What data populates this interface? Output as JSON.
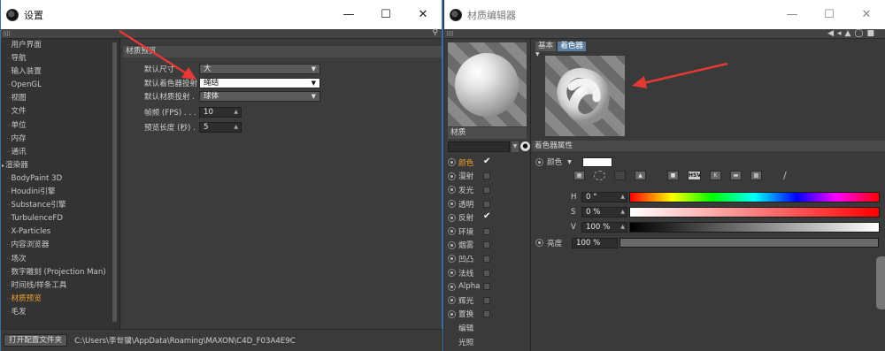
{
  "settings": {
    "title": "设置",
    "sidebar": [
      {
        "label": "用户界面",
        "active": false,
        "expand": false
      },
      {
        "label": "导航",
        "active": false,
        "expand": false
      },
      {
        "label": "输入装置",
        "active": false,
        "expand": false
      },
      {
        "label": "OpenGL",
        "active": false,
        "expand": false
      },
      {
        "label": "视图",
        "active": false,
        "expand": false
      },
      {
        "label": "文件",
        "active": false,
        "expand": false
      },
      {
        "label": "单位",
        "active": false,
        "expand": false
      },
      {
        "label": "内存",
        "active": false,
        "expand": false
      },
      {
        "label": "通讯",
        "active": false,
        "expand": false
      },
      {
        "label": "渲染器",
        "active": false,
        "expand": true
      },
      {
        "label": "BodyPaint 3D",
        "active": false,
        "expand": false
      },
      {
        "label": "Houdini引擎",
        "active": false,
        "expand": false
      },
      {
        "label": "Substance引擎",
        "active": false,
        "expand": false
      },
      {
        "label": "TurbulenceFD",
        "active": false,
        "expand": false
      },
      {
        "label": "X-Particles",
        "active": false,
        "expand": false
      },
      {
        "label": "内容浏览器",
        "active": false,
        "expand": false
      },
      {
        "label": "场次",
        "active": false,
        "expand": false
      },
      {
        "label": "数字雕刻 (Projection Man)",
        "active": false,
        "expand": false
      },
      {
        "label": "时间线/样条工具",
        "active": false,
        "expand": false
      },
      {
        "label": "材质预览",
        "active": true,
        "expand": false
      },
      {
        "label": "毛发",
        "active": false,
        "expand": false
      }
    ],
    "section_title": "材质预览",
    "props": {
      "size_label": "默认尺寸",
      "size_value": "大",
      "shader_label": "默认着色器投射",
      "shader_value": "绳结",
      "material_label": "默认材质投射 .",
      "material_value": "球体",
      "fps_label": "帧频 (FPS) . . . .",
      "fps_value": "10",
      "length_label": "预览长度 (秒) .",
      "length_value": "5"
    },
    "footer": {
      "button": "打开配置文件夹",
      "path": "C:\\Users\\李世骥\\AppData\\Roaming\\MAXON\\C4D_F03A4E9C"
    }
  },
  "material_editor": {
    "title": "材质编辑器",
    "material_name": "材质",
    "channels": [
      {
        "label": "颜色",
        "checked": true,
        "active": true,
        "radio": true
      },
      {
        "label": "漫射",
        "checked": false,
        "active": false,
        "radio": true
      },
      {
        "label": "发光",
        "checked": false,
        "active": false,
        "radio": true
      },
      {
        "label": "透明",
        "checked": false,
        "active": false,
        "radio": true
      },
      {
        "label": "反射",
        "checked": true,
        "active": false,
        "radio": true
      },
      {
        "label": "环境",
        "checked": false,
        "active": false,
        "radio": true
      },
      {
        "label": "烟雾",
        "checked": false,
        "active": false,
        "radio": true
      },
      {
        "label": "凹凸",
        "checked": false,
        "active": false,
        "radio": true
      },
      {
        "label": "法线",
        "checked": false,
        "active": false,
        "radio": true
      },
      {
        "label": "Alpha",
        "checked": false,
        "active": false,
        "radio": true
      },
      {
        "label": "辉光",
        "checked": false,
        "active": false,
        "radio": true
      },
      {
        "label": "置换",
        "checked": false,
        "active": false,
        "radio": true
      },
      {
        "label": "编辑",
        "checked": null,
        "active": false,
        "radio": false
      },
      {
        "label": "光照",
        "checked": null,
        "active": false,
        "radio": false
      }
    ],
    "tabs": [
      "基本",
      "着色器"
    ],
    "active_tab": "着色器",
    "section_title": "着色器属性",
    "color_label": "颜色",
    "color_value": "#ffffff",
    "hsv_label": "HSV",
    "h_label": "H",
    "h_value": "0 °",
    "s_label": "S",
    "s_value": "0 %",
    "v_label": "V",
    "v_value": "100 %",
    "brightness_label": "亮度",
    "brightness_value": "100 %"
  },
  "colors": {
    "accent_orange": "#f0a030",
    "annotation_red": "#e53935",
    "tab_active": "#5b7fa3"
  }
}
